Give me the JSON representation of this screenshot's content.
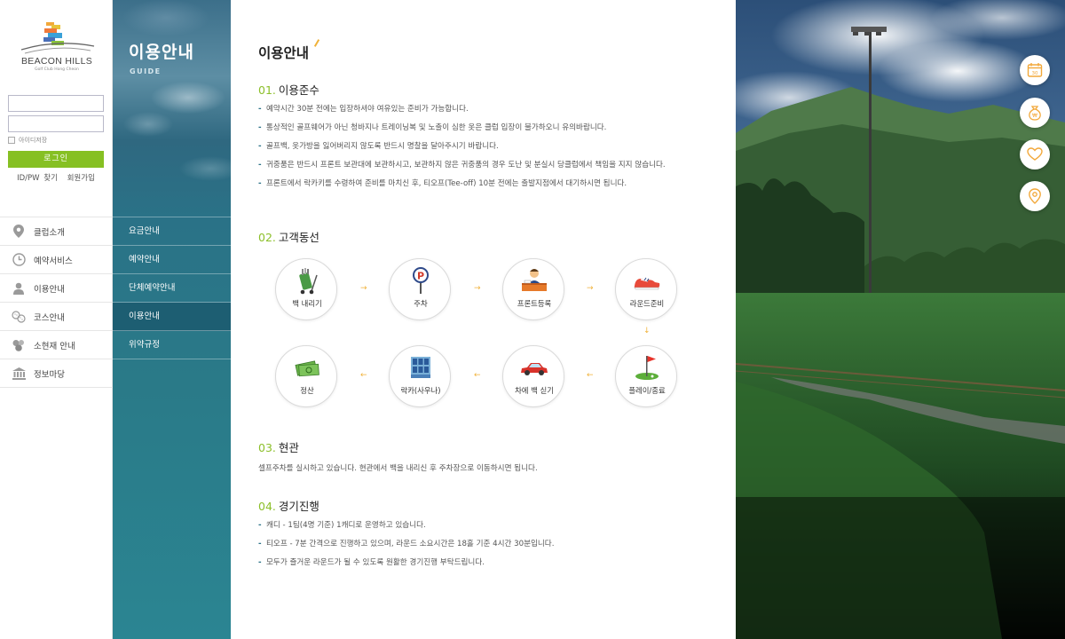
{
  "logo": {
    "name": "BEACON HILLS",
    "sub": "Golf Club Hong Cheon"
  },
  "login": {
    "id_placeholder": "",
    "pw_placeholder": "",
    "remember_label": "아이디저장",
    "login_label": "로그인",
    "find_label": "ID/PW 찾기",
    "join_label": "회원가입"
  },
  "side_menu": [
    {
      "label": "클럽소개",
      "icon": "location-pin-icon"
    },
    {
      "label": "예약서비스",
      "icon": "clock-icon"
    },
    {
      "label": "이용안내",
      "icon": "person-icon"
    },
    {
      "label": "코스안내",
      "icon": "golf-balls-icon"
    },
    {
      "label": "소현재 안내",
      "icon": "users-icon"
    },
    {
      "label": "정보마당",
      "icon": "bank-icon"
    }
  ],
  "subnav": {
    "title": "이용안내",
    "subtitle": "GUIDE",
    "items": [
      {
        "label": "요금안내"
      },
      {
        "label": "예약안내"
      },
      {
        "label": "단체예약안내"
      },
      {
        "label": "이용안내"
      },
      {
        "label": "위약규정"
      }
    ],
    "active_index": 3
  },
  "main": {
    "title": "이용안내",
    "sections": [
      {
        "num": "01.",
        "heading": "이용준수",
        "bullets": [
          "예약시간 30분 전에는 입장하셔야 여유있는 준비가 가능합니다.",
          "통상적인 골프웨어가 아닌 청바지나 트레이닝복 및 노출이 심한 옷은 클럽 입장이 불가하오니 유의바랍니다.",
          "골프백, 옷가방을 잃어버리지 않도록 반드시 명찰을 달아주시기 바랍니다.",
          "귀중품은 반드시 프론트 보관대에 보관하시고, 보관하지 않은 귀중품의 경우 도난 및 분실시 당클럽에서 책임을 지지 않습니다.",
          "프론트에서 락카키를 수령하여 준비를 마치신 후, 티오프(Tee-off) 10분 전에는 출발지점에서 대기하시면 됩니다."
        ]
      },
      {
        "num": "02.",
        "heading": "고객동선"
      },
      {
        "num": "03.",
        "heading": "현관",
        "text": "셀프주차를 실시하고 있습니다. 현관에서 백을 내리신 후 주차장으로 이동하시면 됩니다."
      },
      {
        "num": "04.",
        "heading": "경기진행",
        "bullets": [
          "캐디 - 1팀(4명 기준) 1캐디로 운영하고 있습니다.",
          "티오프 - 7분 간격으로 진행하고 있으며, 라운드 소요시간은 18홀 기준 4시간 30분입니다.",
          "모두가 즐거운 라운드가 될 수 있도록 원활한 경기진행 부탁드립니다."
        ]
      }
    ],
    "flow": [
      {
        "label": "백 내리기",
        "icon": "golf-bag-cart-icon"
      },
      {
        "label": "주차",
        "icon": "parking-sign-icon"
      },
      {
        "label": "프론트등록",
        "icon": "front-desk-icon"
      },
      {
        "label": "라운드준비",
        "icon": "golf-shoe-icon"
      },
      {
        "label": "플레이/종료",
        "icon": "golf-flag-icon"
      },
      {
        "label": "차에 백 싣기",
        "icon": "car-icon"
      },
      {
        "label": "락카(사우나)",
        "icon": "locker-icon"
      },
      {
        "label": "정산",
        "icon": "money-icon"
      }
    ],
    "arrows": {
      "right": "→",
      "down": "↓",
      "left": "←"
    }
  },
  "quick_menu": [
    {
      "icon": "calendar-icon"
    },
    {
      "icon": "money-bag-icon"
    },
    {
      "icon": "heart-icon"
    },
    {
      "icon": "map-pin-icon"
    }
  ],
  "colors": {
    "accent_green": "#86c023",
    "teal": "#2a7287",
    "arrow_orange": "#f0b23a"
  }
}
